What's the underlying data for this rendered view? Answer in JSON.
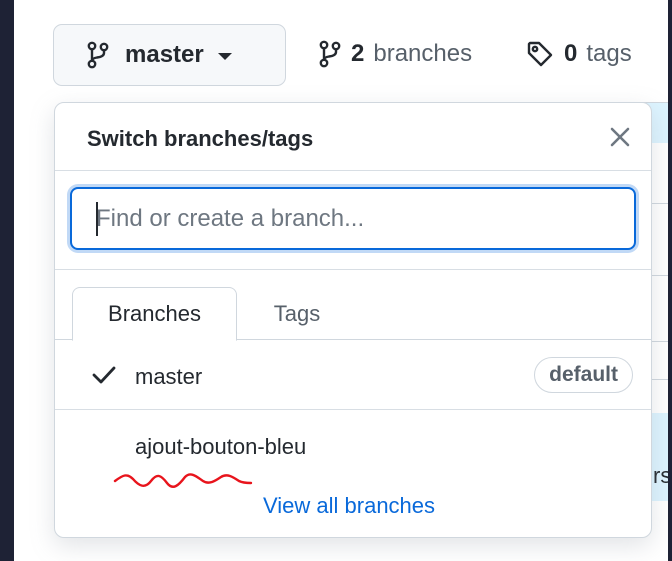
{
  "toolbar": {
    "current_branch": "master",
    "branch_count": "2",
    "branches_label": "branches",
    "tag_count": "0",
    "tags_label": "tags"
  },
  "popup": {
    "title": "Switch branches/tags",
    "filter_placeholder": "Find or create a branch...",
    "tabs": [
      {
        "label": "Branches",
        "active": true
      },
      {
        "label": "Tags",
        "active": false
      }
    ],
    "branches": [
      {
        "name": "master",
        "selected": true,
        "badge": "default"
      },
      {
        "name": "ajout-bouton-bleu",
        "selected": false
      }
    ],
    "view_all_label": "View all branches"
  },
  "background": {
    "row_text": "rs"
  },
  "icons": {
    "branch": "git-branch-icon",
    "tag": "tag-icon",
    "close": "close-icon",
    "check": "check-icon",
    "caret": "caret-down-icon"
  },
  "colors": {
    "accent": "#0969da",
    "border": "#d0d7de",
    "annotation": "#e8141c",
    "outer": "#1e2235"
  }
}
